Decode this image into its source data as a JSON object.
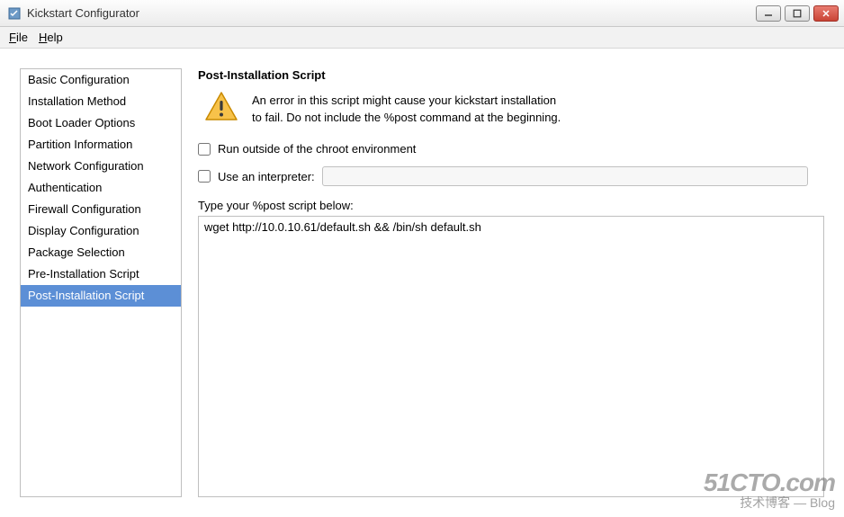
{
  "window": {
    "title": "Kickstart Configurator"
  },
  "menubar": {
    "file": "File",
    "help": "Help"
  },
  "sidebar": {
    "items": [
      "Basic Configuration",
      "Installation Method",
      "Boot Loader Options",
      "Partition Information",
      "Network Configuration",
      "Authentication",
      "Firewall Configuration",
      "Display Configuration",
      "Package Selection",
      "Pre-Installation Script",
      "Post-Installation Script"
    ],
    "selected_index": 10
  },
  "main": {
    "title": "Post-Installation Script",
    "warning_line1": "An error in this script might cause your kickstart installation",
    "warning_line2": "to fail. Do not include the %post command at the beginning.",
    "chroot_checkbox_label": "Run outside of the chroot environment",
    "chroot_checked": false,
    "interpreter_checkbox_label": "Use an interpreter:",
    "interpreter_checked": false,
    "interpreter_value": "",
    "type_label": "Type your %post script below:",
    "script_value": "wget http://10.0.10.61/default.sh && /bin/sh default.sh"
  },
  "watermark": {
    "big": "51CTO.com",
    "sub": "技术博客 — Blog"
  }
}
